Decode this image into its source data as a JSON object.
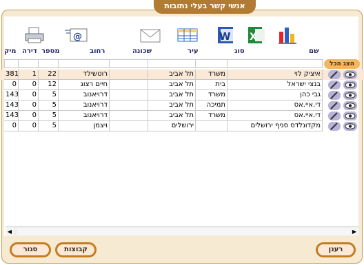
{
  "window": {
    "title": "אנשי קשר בעלי נתובות"
  },
  "toolbar": {
    "icons": [
      "chart-icon",
      "excel-icon",
      "word-icon",
      "table-icon",
      "envelope-icon",
      "email-icon",
      "printer-icon"
    ]
  },
  "table": {
    "headers": {
      "name": "שם",
      "type": "סוג",
      "city": "עיר",
      "neighborhood": "שכונה",
      "street": "רחוב",
      "number": "מספר",
      "apartment": "דירה",
      "zip": "מיק"
    },
    "show_all_label": "הצג הכל",
    "rows": [
      {
        "name": "איציק לוי",
        "type": "משרד",
        "city": "תל אביב",
        "neighborhood": "",
        "street": "רוטשילד",
        "number": "22",
        "apartment": "1",
        "zip": "381"
      },
      {
        "name": "בנצי ישראל",
        "type": "בית",
        "city": "תל אביב",
        "neighborhood": "",
        "street": "חיים רצוג",
        "number": "12",
        "apartment": "0",
        "zip": "0"
      },
      {
        "name": "גבי כהן",
        "type": "משרד",
        "city": "תל אביב",
        "neighborhood": "",
        "street": "דרויאנוב",
        "number": "5",
        "apartment": "0",
        "zip": "143"
      },
      {
        "name": "די.איי.אס",
        "type": "תמיכה",
        "city": "תל אביב",
        "neighborhood": "",
        "street": "דרויאנוב",
        "number": "5",
        "apartment": "0",
        "zip": "143"
      },
      {
        "name": "די.איי.אס",
        "type": "משרד",
        "city": "תל אביב",
        "neighborhood": "",
        "street": "דרויאנוב",
        "number": "5",
        "apartment": "0",
        "zip": "143"
      },
      {
        "name": "מקדונלדס סניף ירושלים",
        "type": "",
        "city": "ירושלים",
        "neighborhood": "",
        "street": "ויצמן",
        "number": "5",
        "apartment": "0",
        "zip": "0"
      }
    ]
  },
  "buttons": {
    "refresh": "רענן",
    "groups": "קבוצות",
    "close": "סגור"
  },
  "colors": {
    "accent": "#c57b1e",
    "frame": "#f7ead2",
    "selected_row": "#fbe9d8"
  }
}
